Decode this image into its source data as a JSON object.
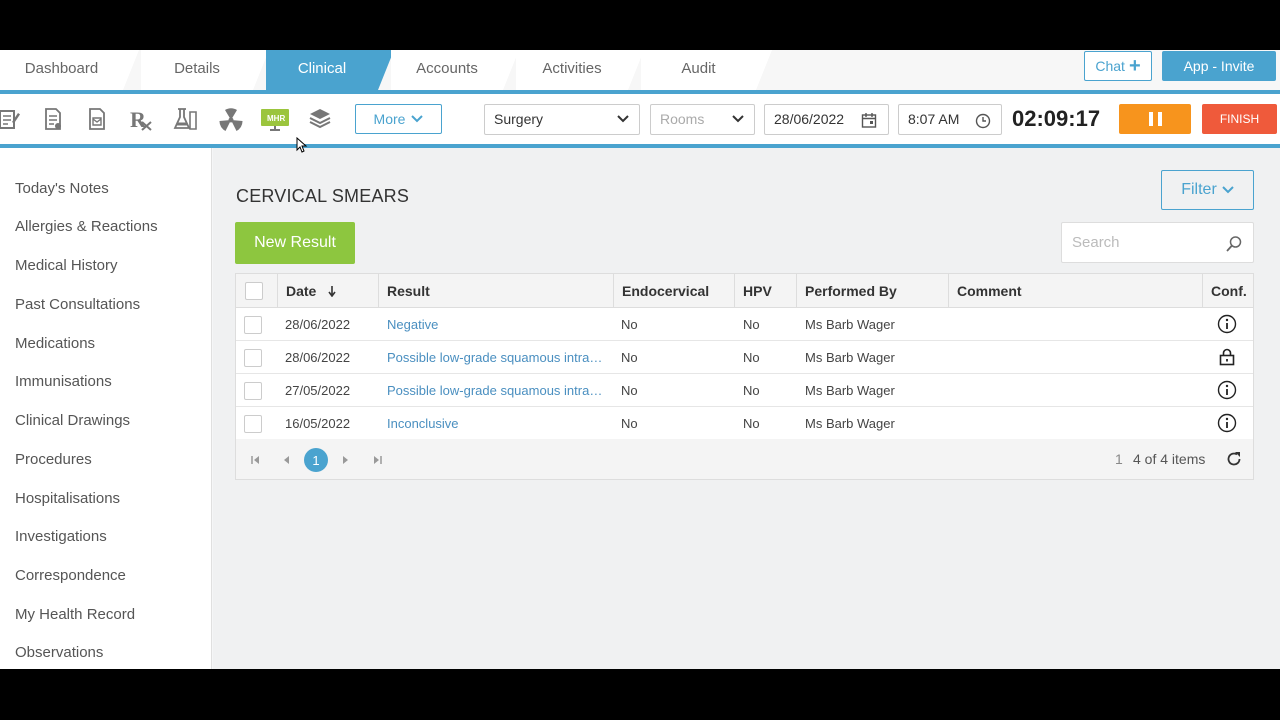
{
  "tabs": [
    {
      "label": "Dashboard"
    },
    {
      "label": "Details"
    },
    {
      "label": "Clinical"
    },
    {
      "label": "Accounts"
    },
    {
      "label": "Activities"
    },
    {
      "label": "Audit"
    }
  ],
  "header": {
    "chat_label": "Chat",
    "invite_label": "App - Invite"
  },
  "toolbar": {
    "icons": [
      "notes-icon",
      "document-icon",
      "letter-icon",
      "prescription-icon",
      "lab-flask-icon",
      "radiation-icon",
      "mhr-monitor-icon",
      "stack-icon"
    ],
    "more_label": "More",
    "location": "Surgery",
    "rooms_placeholder": "Rooms",
    "date": "28/06/2022",
    "time": "8:07 AM",
    "timer": "02:09:17",
    "finish_label": "FINISH"
  },
  "sidebar": {
    "items": [
      {
        "label": "Today's Notes"
      },
      {
        "label": "Allergies & Reactions"
      },
      {
        "label": "Medical History"
      },
      {
        "label": "Past Consultations"
      },
      {
        "label": "Medications"
      },
      {
        "label": "Immunisations"
      },
      {
        "label": "Clinical Drawings"
      },
      {
        "label": "Procedures"
      },
      {
        "label": "Hospitalisations"
      },
      {
        "label": "Investigations"
      },
      {
        "label": "Correspondence"
      },
      {
        "label": "My Health Record"
      },
      {
        "label": "Observations"
      }
    ]
  },
  "main": {
    "title": "CERVICAL SMEARS",
    "filter_label": "Filter",
    "new_result_label": "New Result",
    "search_placeholder": "Search",
    "columns": {
      "date": "Date",
      "result": "Result",
      "endocervical": "Endocervical",
      "hpv": "HPV",
      "performed_by": "Performed By",
      "comment": "Comment",
      "conf": "Conf."
    },
    "rows": [
      {
        "date": "28/06/2022",
        "result": "Negative",
        "endocervical": "No",
        "hpv": "No",
        "performed_by": "Ms Barb Wager",
        "comment": "",
        "conf": "info-icon"
      },
      {
        "date": "28/06/2022",
        "result": "Possible low-grade squamous intraepithelial lesion",
        "endocervical": "No",
        "hpv": "No",
        "performed_by": "Ms Barb Wager",
        "comment": "",
        "conf": "lock-icon"
      },
      {
        "date": "27/05/2022",
        "result": "Possible low-grade squamous intraepithelial lesion",
        "endocervical": "No",
        "hpv": "No",
        "performed_by": "Ms Barb Wager",
        "comment": "",
        "conf": "info-icon"
      },
      {
        "date": "16/05/2022",
        "result": "Inconclusive",
        "endocervical": "No",
        "hpv": "No",
        "performed_by": "Ms Barb Wager",
        "comment": "",
        "conf": "info-icon"
      }
    ],
    "pager": {
      "current_page": "1",
      "page_input": "1",
      "info": "4 of 4 items"
    }
  },
  "colors": {
    "accent": "#4aa3cf",
    "green": "#8dc63f",
    "orange": "#f7941d",
    "red": "#ef5a3b"
  }
}
